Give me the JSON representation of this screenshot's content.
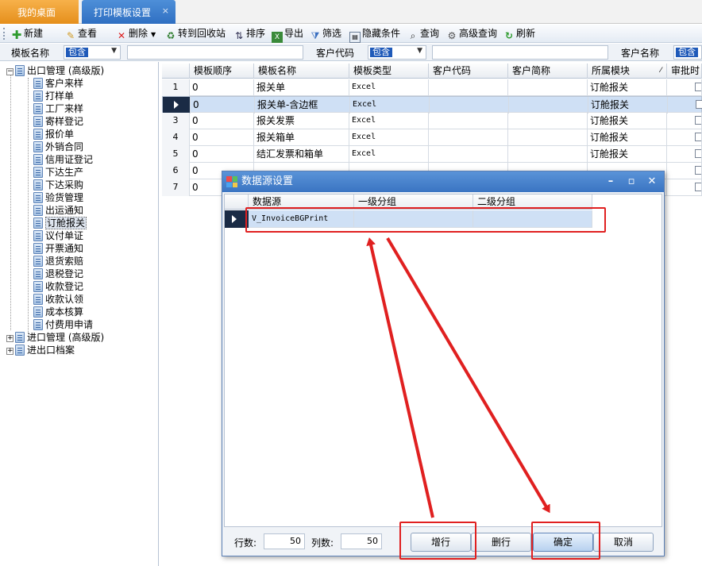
{
  "tabs": [
    {
      "label": "我的桌面"
    },
    {
      "label": "打印模板设置",
      "close": "×"
    }
  ],
  "toolbar": {
    "new": "新建",
    "view": "查看",
    "delete": "删除",
    "recycle": "转到回收站",
    "sort": "排序",
    "export": "导出",
    "filter": "筛选",
    "hide": "隐藏条件",
    "query": "查询",
    "advquery": "高级查询",
    "refresh": "刷新"
  },
  "filters": {
    "f1_label": "模板名称",
    "f1_op": "包含",
    "f2_label": "客户代码",
    "f2_op": "包含",
    "f3_label": "客户名称",
    "f3_op": "包含"
  },
  "tree": {
    "root1": "出口管理 (高级版)",
    "children": [
      "客户来样",
      "打样单",
      "工厂来样",
      "寄样登记",
      "报价单",
      "外销合同",
      "信用证登记",
      "下达生产",
      "下达采购",
      "验货管理",
      "出运通知",
      "订舱报关",
      "议付单证",
      "开票通知",
      "退货索赔",
      "退税登记",
      "收款登记",
      "收款认领",
      "成本核算",
      "付费用申请"
    ],
    "root2": "进口管理 (高级版)",
    "root3": "进出口档案"
  },
  "grid": {
    "headers": [
      "模板顺序",
      "模板名称",
      "模板类型",
      "客户代码",
      "客户简称",
      "所属模块",
      "审批时"
    ],
    "rows": [
      {
        "no": "1",
        "order": "0",
        "name": "报关单",
        "type": "Excel",
        "module": "订舱报关"
      },
      {
        "no": "",
        "order": "0",
        "name": "报关单-含边框",
        "type": "Excel",
        "module": "订舱报关"
      },
      {
        "no": "3",
        "order": "0",
        "name": "报关发票",
        "type": "Excel",
        "module": "订舱报关"
      },
      {
        "no": "4",
        "order": "0",
        "name": "报关箱单",
        "type": "Excel",
        "module": "订舱报关"
      },
      {
        "no": "5",
        "order": "0",
        "name": "结汇发票和箱单",
        "type": "Excel",
        "module": "订舱报关"
      },
      {
        "no": "6",
        "order": "0",
        "name": "",
        "type": "",
        "module": ""
      },
      {
        "no": "7",
        "order": "0",
        "name": "",
        "type": "",
        "module": ""
      }
    ]
  },
  "dialog": {
    "title": "数据源设置",
    "headers": [
      "数据源",
      "一级分组",
      "二级分组"
    ],
    "row": {
      "source": "V_InvoiceBGPrint",
      "group1": "",
      "group2": ""
    },
    "rows_label": "行数:",
    "rows_value": "50",
    "cols_label": "列数:",
    "cols_value": "50",
    "add_row": "增行",
    "del_row": "删行",
    "ok": "确定",
    "cancel": "取消"
  }
}
